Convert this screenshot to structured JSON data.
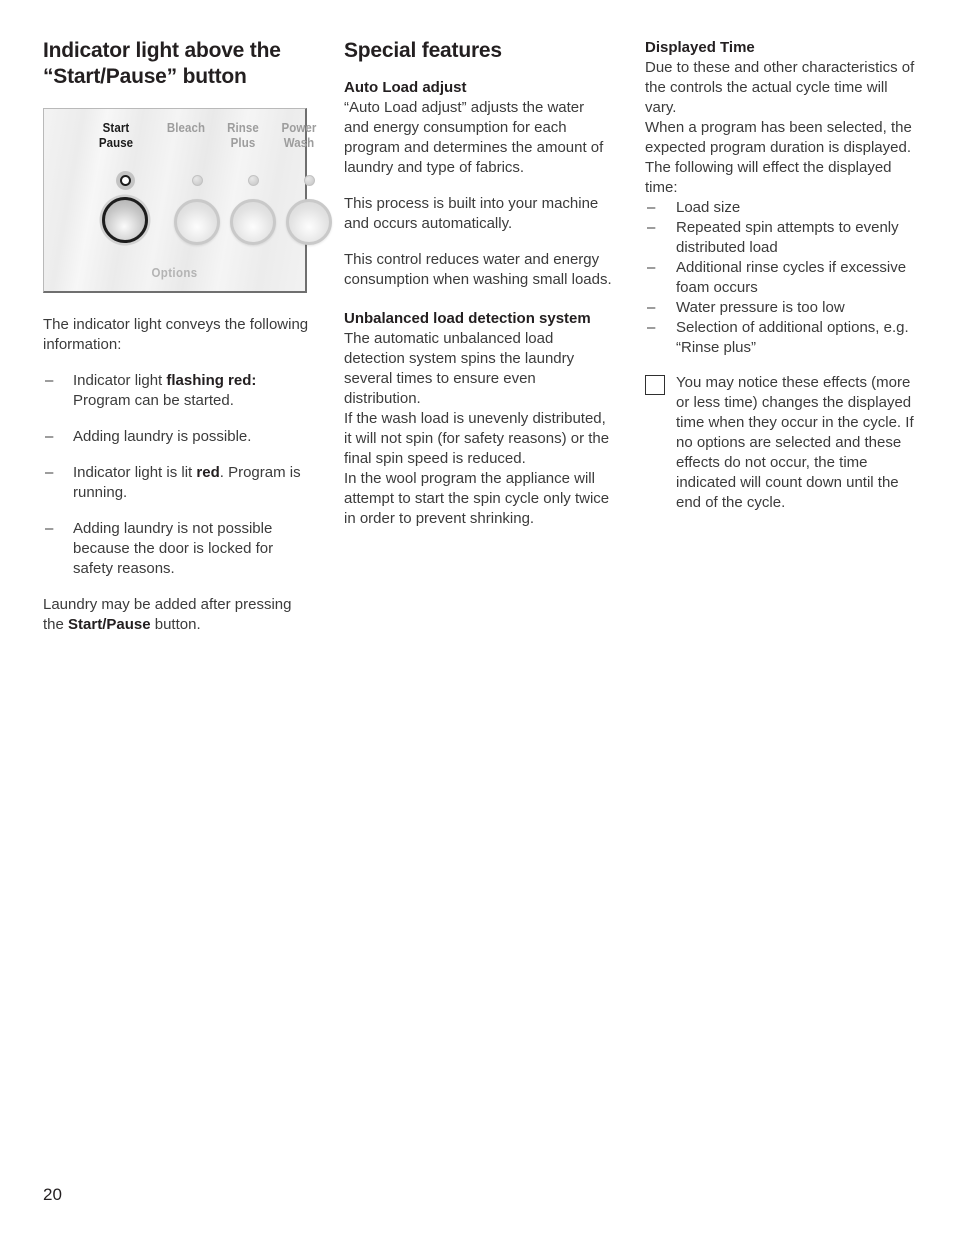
{
  "page": {
    "number": "20"
  },
  "column1": {
    "heading": "Indicator light above the “Start/Pause” button",
    "panel": {
      "labels": {
        "start": "Start",
        "pause": "Pause",
        "bleach": "Bleach",
        "rinse": "Rinse",
        "plus": "Plus",
        "power": "Power",
        "wash": "Wash",
        "options": "Options"
      },
      "leds": [
        {
          "name": "start-pause-indicator",
          "state": "active"
        },
        {
          "name": "bleach-indicator",
          "state": "idle"
        },
        {
          "name": "rinse-plus-indicator",
          "state": "idle"
        },
        {
          "name": "power-wash-indicator",
          "state": "idle"
        }
      ],
      "buttons": [
        {
          "name": "start-pause-button",
          "state": "active"
        },
        {
          "name": "bleach-button",
          "state": "idle"
        },
        {
          "name": "rinse-plus-button",
          "state": "idle"
        },
        {
          "name": "power-wash-button",
          "state": "idle"
        }
      ]
    },
    "intro": "The indicator light conveys the following information:",
    "bullets": [
      {
        "dash": "–",
        "lead": "Indicator light ",
        "bold": "flashing red:",
        "rest": " Program can be started."
      },
      {
        "dash": "–",
        "lead": "Adding laundry is possible.",
        "bold": "",
        "rest": ""
      },
      {
        "dash": "–",
        "lead": "Indicator light is lit ",
        "bold": "red",
        "rest": ". Program is running."
      },
      {
        "dash": "–",
        "lead": "Adding laundry is not possible because the door is locked for safety reasons.",
        "bold": "",
        "rest": ""
      }
    ],
    "closing": {
      "lead": "Laundry may be added after pressing the ",
      "bold": "Start/Pause",
      "rest": " button."
    }
  },
  "column2": {
    "heading": "Special features",
    "section1": {
      "subheading": "Auto Load adjust",
      "paragraphs": [
        "“Auto Load adjust” adjusts the water and energy consumption for each program and determines the amount of laundry and type of fabrics.",
        "This process is built into your machine and occurs automatically.",
        "This control reduces water and energy consumption when washing small loads."
      ]
    },
    "section2": {
      "subheading": "Unbalanced load detection system",
      "paragraphs": [
        "The automatic unbalanced load detection system spins the laundry several times to ensure even distribution.",
        "If the wash load is unevenly distributed, it will not spin (for safety reasons) or the final spin speed is reduced.",
        "In the wool program the appliance will attempt to start the spin cycle only twice in order to prevent shrinking."
      ]
    }
  },
  "column3": {
    "subheading": "Displayed Time",
    "paragraphs": [
      "Due to these and other characteristics of the controls the actual cycle time will vary.",
      "When a program has been selected, the expected program duration is displayed.",
      "The following will effect the displayed time:"
    ],
    "bullets": [
      {
        "dash": "–",
        "text": "Load size"
      },
      {
        "dash": "–",
        "text": "Repeated spin attempts to evenly distributed load"
      },
      {
        "dash": "–",
        "text": "Additional rinse cycles if excessive foam occurs"
      },
      {
        "dash": "–",
        "text": "Water pressure is too low"
      },
      {
        "dash": "–",
        "text": "Selection of additional options, e.g. “Rinse plus”"
      }
    ],
    "note": "You may notice these effects (more or less time) changes the displayed time when they occur in the cycle. If no options are selected and these effects do not occur, the time indicated will count down until the end of the cycle."
  }
}
